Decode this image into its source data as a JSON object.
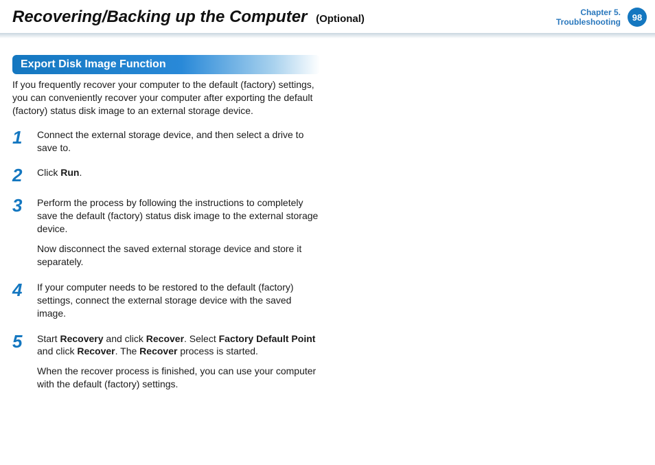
{
  "header": {
    "title": "Recovering/Backing up the Computer",
    "suffix": "(Optional)",
    "chapter_line1": "Chapter 5.",
    "chapter_line2": "Troubleshooting",
    "page": "98"
  },
  "section": {
    "heading": "Export Disk Image Function",
    "intro": "If you frequently recover your computer to the default (factory) settings, you can conveniently recover your computer after exporting the default (factory) status disk image to an external storage device."
  },
  "steps": [
    {
      "n": "1",
      "html": "Connect the external storage device, and then select a drive to save to."
    },
    {
      "n": "2",
      "html": "Click <span class='b'>Run</span>."
    },
    {
      "n": "3",
      "html": "Perform the process by following the instructions to completely save the default (factory) status disk image to the external storage device.",
      "sub": "Now disconnect the saved external storage device and store it separately."
    },
    {
      "n": "4",
      "html": "If your computer needs to be restored to the default (factory) settings, connect the external storage device with the saved image."
    },
    {
      "n": "5",
      "html": "Start <span class='b'>Recovery</span> and click <span class='b'>Recover</span>. Select <span class='b'>Factory Default Point</span> and click <span class='b'>Recover</span>. The <span class='b'>Recover</span> process is started.",
      "sub": "When the recover process is finished, you can use your computer with the default (factory) settings."
    }
  ]
}
